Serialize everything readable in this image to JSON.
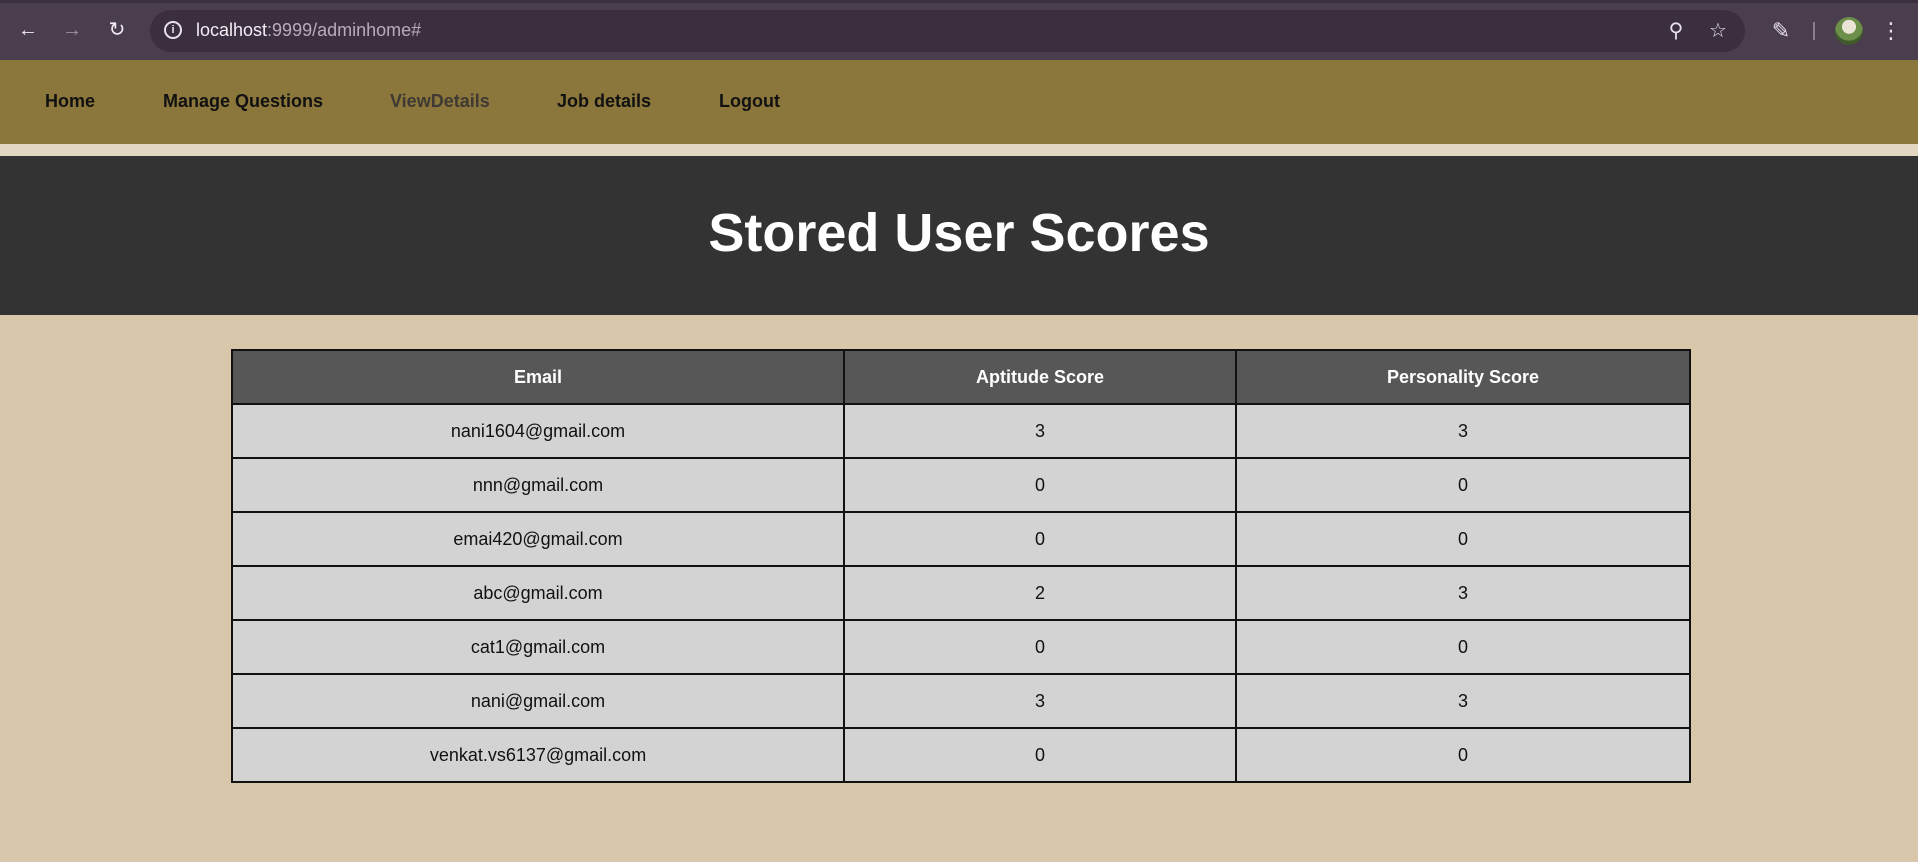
{
  "browser": {
    "url_host": "localhost",
    "url_rest": ":9999/adminhome#"
  },
  "nav": {
    "items": [
      {
        "label": "Home"
      },
      {
        "label": "Manage Questions"
      },
      {
        "label": "ViewDetails"
      },
      {
        "label": "Job details"
      },
      {
        "label": "Logout"
      }
    ]
  },
  "page": {
    "title": "Stored User Scores"
  },
  "table": {
    "headers": [
      "Email",
      "Aptitude Score",
      "Personality Score"
    ],
    "rows": [
      [
        "nani1604@gmail.com",
        "3",
        "3"
      ],
      [
        "nnn@gmail.com",
        "0",
        "0"
      ],
      [
        "emai420@gmail.com",
        "0",
        "0"
      ],
      [
        "abc@gmail.com",
        "2",
        "3"
      ],
      [
        "cat1@gmail.com",
        "0",
        "0"
      ],
      [
        "nani@gmail.com",
        "3",
        "3"
      ],
      [
        "venkat.vs6137@gmail.com",
        "0",
        "0"
      ]
    ]
  },
  "colors": {
    "nav_bg": "#8b773b",
    "header_bg": "#333333",
    "page_bg": "#d9c7ab",
    "table_header_bg": "#575757",
    "table_cell_bg": "#d3d3d3"
  }
}
